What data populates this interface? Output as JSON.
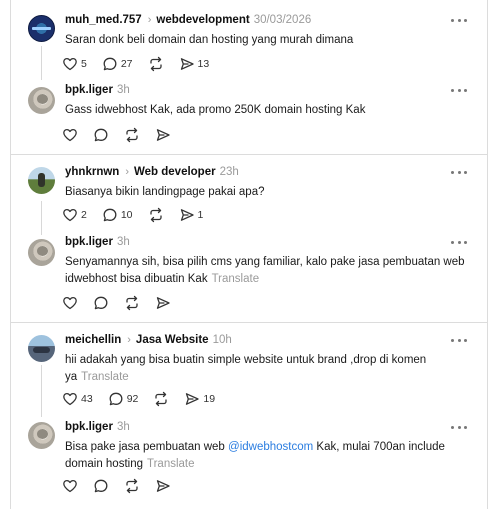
{
  "threads": [
    {
      "post": {
        "username": "muh_med.757",
        "community": "webdevelopment",
        "time": "30/03/2026",
        "text": "Saran donk beli domain dan hosting yang murah dimana",
        "likes": "5",
        "comments": "27",
        "shares": "13"
      },
      "reply": {
        "username": "bpk.liger",
        "time": "3h",
        "text": "Gass idwebhost Kak, ada promo 250K domain hosting Kak"
      }
    },
    {
      "post": {
        "username": "yhnkrnwn",
        "community": "Web developer",
        "time": "23h",
        "text": "Biasanya bikin landingpage pakai apa?",
        "likes": "2",
        "comments": "10",
        "shares": "1"
      },
      "reply": {
        "username": "bpk.liger",
        "time": "3h",
        "text": "Senyamannya sih, bisa pilih cms yang familiar, kalo pake jasa pembuatan web idwebhost bisa dibuatin Kak",
        "translate": "Translate"
      }
    },
    {
      "post": {
        "username": "meichellin",
        "community": "Jasa Website",
        "time": "10h",
        "text": "hii adakah yang bisa buatin simple website untuk brand ,drop di komen ya",
        "translate": "Translate",
        "likes": "43",
        "comments": "92",
        "shares": "19"
      },
      "reply": {
        "username": "bpk.liger",
        "time": "3h",
        "text_before": "Bisa pake jasa pembuatan web ",
        "mention": "@idwebhostcom",
        "text_after": " Kak, mulai 700an include domain hosting",
        "translate": "Translate"
      }
    }
  ],
  "colors": {
    "mention": "#2b7de0",
    "muted": "#9a9a9a",
    "divider": "#dcdcdc"
  },
  "icons": [
    "heart-icon",
    "comment-icon",
    "repost-icon",
    "share-icon",
    "more-icon",
    "chevron-right-icon"
  ]
}
